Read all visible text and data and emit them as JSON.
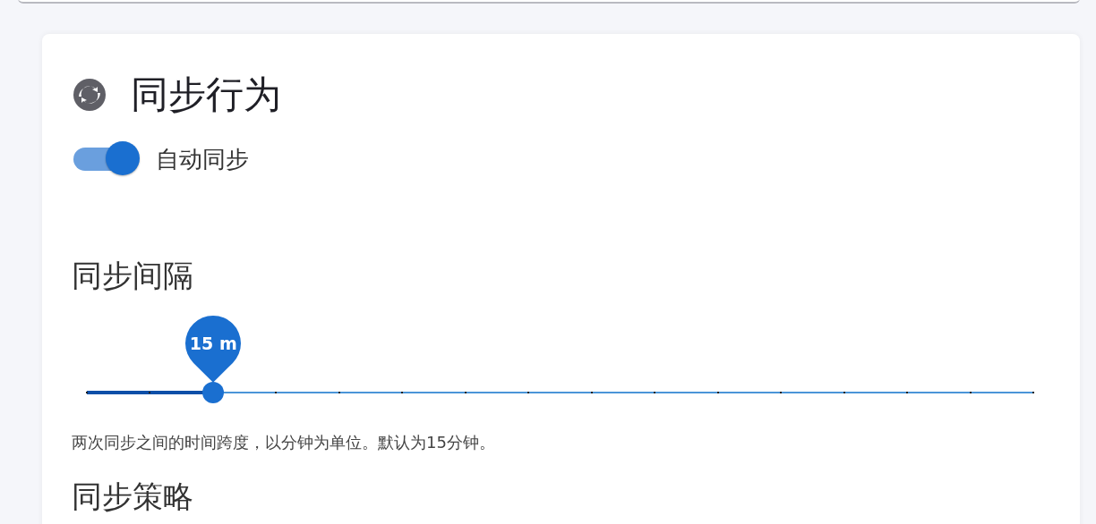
{
  "section": {
    "title": "同步行为",
    "auto_sync": {
      "label": "自动同步",
      "on": true
    },
    "interval": {
      "label": "同步间隔",
      "value_label": "15 m",
      "level": 0.1333,
      "description": "两次同步之间的时间跨度，以分钟为单位。默认为15分钟。"
    },
    "next_heading": "同步策略"
  }
}
